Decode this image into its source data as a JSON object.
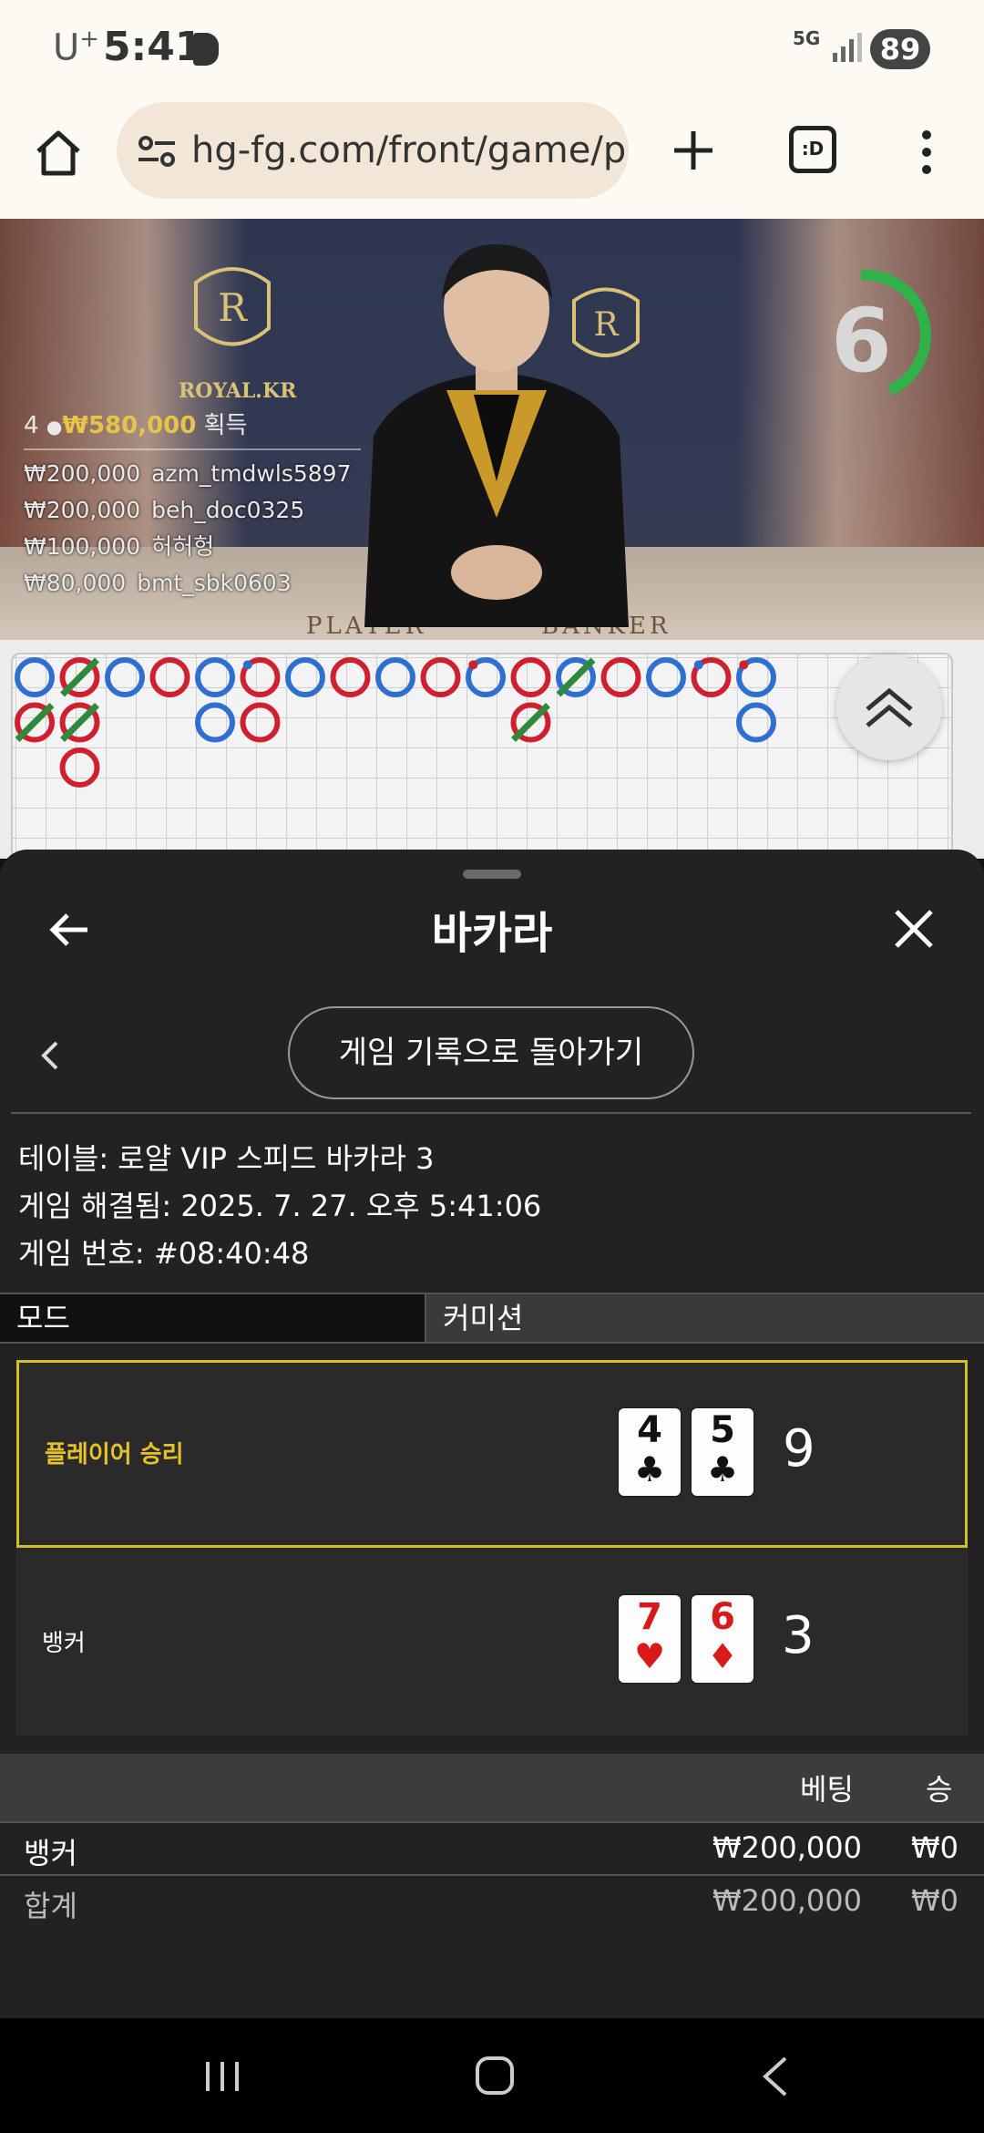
{
  "status": {
    "carrier": "U",
    "carrier_sup": "+",
    "time": "5:41",
    "network": "5G",
    "battery": "89"
  },
  "browser": {
    "url": "hg-fg.com/front/game/p",
    "tabs_icon_text": ":D"
  },
  "video": {
    "crest_label": "ROYAL.KR",
    "countdown": "6",
    "winners_count": "4",
    "winners_total": "₩580,000",
    "winners_suffix": "획득",
    "winners": [
      {
        "amount": "₩200,000",
        "user": "azm_tmdwls5897"
      },
      {
        "amount": "₩200,000",
        "user": "beh_doc0325"
      },
      {
        "amount": "₩100,000",
        "user": "허허헝"
      },
      {
        "amount": "₩80,000",
        "user": "bmt_sbk0603"
      }
    ],
    "table_player": "PLAYER",
    "table_banker": "BANKER"
  },
  "bead_road": {
    "colors": {
      "player": "#2f6fd0",
      "banker": "#cf2030",
      "tie": "#2f8a3c"
    },
    "columns": [
      [
        "P",
        "B-tie"
      ],
      [
        "B-tie",
        "B-tie",
        "B"
      ],
      [
        "P"
      ],
      [
        "B"
      ],
      [
        "P",
        "P"
      ],
      [
        "B-bp",
        "B"
      ],
      [
        "P"
      ],
      [
        "B"
      ],
      [
        "P"
      ],
      [
        "B"
      ],
      [
        "P-bp"
      ],
      [
        "B",
        "B-tie"
      ],
      [
        "P-tie"
      ],
      [
        "B"
      ],
      [
        "P"
      ],
      [
        "B-bp"
      ],
      [
        "P-bp",
        "P"
      ]
    ]
  },
  "sheet": {
    "title": "바카라",
    "return_button": "게임 기록으로 돌아가기",
    "table_line": "테이블: 로얄 VIP 스피드 바카라 3",
    "resolved_line": "게임 해결됨: 2025. 7. 27. 오후 5:41:06",
    "game_no_line": "게임 번호: #08:40:48",
    "mode_header": "모드",
    "commission_header": "커미션",
    "results": [
      {
        "label": "플레이어 승리",
        "winner": true,
        "cards": [
          {
            "rank": "4",
            "suit": "♣",
            "color": "black"
          },
          {
            "rank": "5",
            "suit": "♣",
            "color": "black"
          }
        ],
        "score": "9"
      },
      {
        "label": "뱅커",
        "winner": false,
        "cards": [
          {
            "rank": "7",
            "suit": "♥",
            "color": "red"
          },
          {
            "rank": "6",
            "suit": "♦",
            "color": "red"
          }
        ],
        "score": "3"
      }
    ],
    "bets_header": {
      "bet": "베팅",
      "win": "승"
    },
    "bets": [
      {
        "name": "뱅커",
        "amount": "₩200,000",
        "won": "₩0"
      }
    ],
    "total": {
      "name": "합계",
      "amount": "₩200,000",
      "won": "₩0"
    }
  }
}
